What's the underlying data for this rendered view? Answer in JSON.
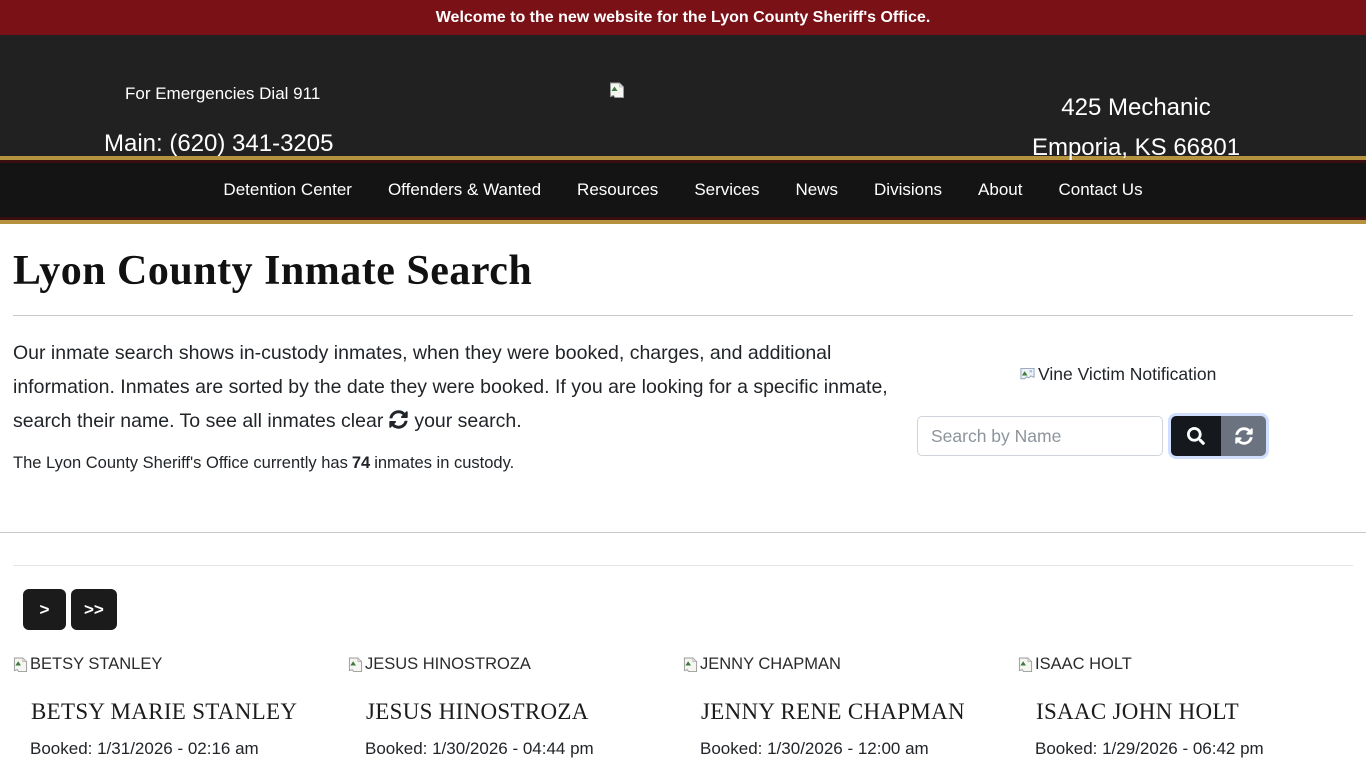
{
  "banner": {
    "text": "Welcome to the new website for the Lyon County Sheriff's Office."
  },
  "header": {
    "emergency": "For Emergencies Dial 911",
    "phone": "Main: (620) 341-3205",
    "address_line1": "425 Mechanic",
    "address_line2": "Emporia, KS 66801"
  },
  "nav": {
    "items": [
      {
        "label": "Detention Center"
      },
      {
        "label": "Offenders & Wanted"
      },
      {
        "label": "Resources"
      },
      {
        "label": "Services"
      },
      {
        "label": "News"
      },
      {
        "label": "Divisions"
      },
      {
        "label": "About"
      },
      {
        "label": "Contact Us"
      }
    ]
  },
  "main": {
    "title": "Lyon County Inmate Search",
    "intro_before": "Our inmate search shows in-custody inmates, when they were booked, charges, and additional information. Inmates are sorted by the date they were booked. If you are looking for a specific inmate, search their name. To see all inmates clear",
    "intro_after": "your search.",
    "count_before": "The Lyon County Sheriff's Office currently has",
    "count": "74",
    "count_after": "inmates in custody."
  },
  "sidebar": {
    "vine_label": "Vine Victim Notification",
    "search": {
      "placeholder": "Search by Name"
    }
  },
  "pagination": {
    "next_label": ">",
    "last_label": ">>"
  },
  "inmates": [
    {
      "alt": "BETSY STANLEY",
      "name": "BETSY MARIE STANLEY",
      "booked": "Booked: 1/31/2026 - 02:16 am"
    },
    {
      "alt": "JESUS HINOSTROZA",
      "name": "JESUS HINOSTROZA",
      "booked": "Booked: 1/30/2026 - 04:44 pm"
    },
    {
      "alt": "JENNY CHAPMAN",
      "name": "JENNY RENE CHAPMAN",
      "booked": "Booked: 1/30/2026 - 12:00 am"
    },
    {
      "alt": "ISAAC HOLT",
      "name": "ISAAC JOHN HOLT",
      "booked": "Booked: 1/29/2026 - 06:42 pm"
    }
  ],
  "colors": {
    "banner_maroon": "#7a1116",
    "header_black": "#212121",
    "nav_black": "#141414",
    "nav_gold_border": "#b4923e",
    "nav_maroon_stripe": "#390e10",
    "search_button_dark": "#15181d",
    "refresh_button_gray": "#6b7380",
    "text_primary": "#212529"
  }
}
